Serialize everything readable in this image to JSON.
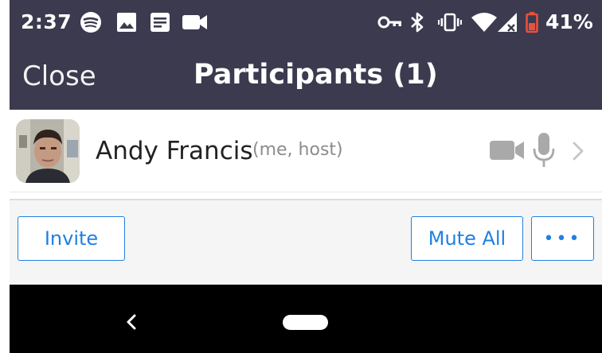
{
  "status_bar": {
    "time": "2:37",
    "battery_percent": "41%",
    "icons_left": [
      "spotify-icon",
      "image-icon",
      "news-icon",
      "video-camera-icon"
    ],
    "icons_right": [
      "vpn-key-icon",
      "bluetooth-icon",
      "vibrate-icon",
      "wifi-icon",
      "signal-icon",
      "battery-low-icon"
    ]
  },
  "header": {
    "close_label": "Close",
    "title": "Participants (1)"
  },
  "participants": [
    {
      "name": "Andy Francis",
      "tag": "(me, host)",
      "icons": [
        "video-camera-icon",
        "microphone-icon",
        "chevron-right-icon"
      ]
    }
  ],
  "actions": {
    "invite_label": "Invite",
    "mute_all_label": "Mute All",
    "more_label": "•••"
  },
  "colors": {
    "header_bg": "#3b3a4f",
    "accent": "#1f80e2",
    "battery_low": "#e8513d"
  }
}
